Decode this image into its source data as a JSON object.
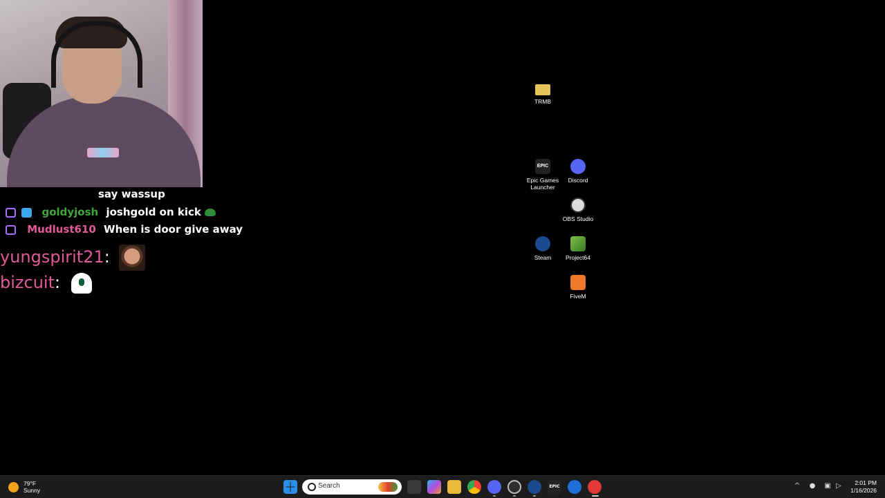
{
  "chat": {
    "line1_text": "say wassup",
    "line2_user": "goldyjosh",
    "line2_text": "joshgold on kick",
    "line3_user": "Mudlust610",
    "line3_text": "When is door give away",
    "line4_user": "yungspirit21",
    "line5_user": "bizcuit",
    "separator": ":"
  },
  "desktop": {
    "icons": [
      {
        "label": "TRMB",
        "icon": "folder-icon"
      },
      {
        "label": "Epic Games Launcher",
        "icon": "epic-games-icon",
        "glyph": "EPIC"
      },
      {
        "label": "Discord",
        "icon": "discord-icon"
      },
      {
        "label": "OBS Studio",
        "icon": "obs-icon"
      },
      {
        "label": "Steam",
        "icon": "steam-icon"
      },
      {
        "label": "Project64",
        "icon": "project64-icon"
      },
      {
        "label": "FiveM",
        "icon": "fivem-icon"
      }
    ]
  },
  "taskbar": {
    "weather_temp": "79°F",
    "weather_cond": "Sunny",
    "search_placeholder": "Search",
    "epic_glyph": "EPIC",
    "time": "2:01 PM",
    "date": "1/16/2026",
    "tray_chevron": "^"
  },
  "colors": {
    "name_green": "#3fa63a",
    "name_pink": "#e05a9a",
    "taskbar_bg": "#1c1c1c"
  }
}
